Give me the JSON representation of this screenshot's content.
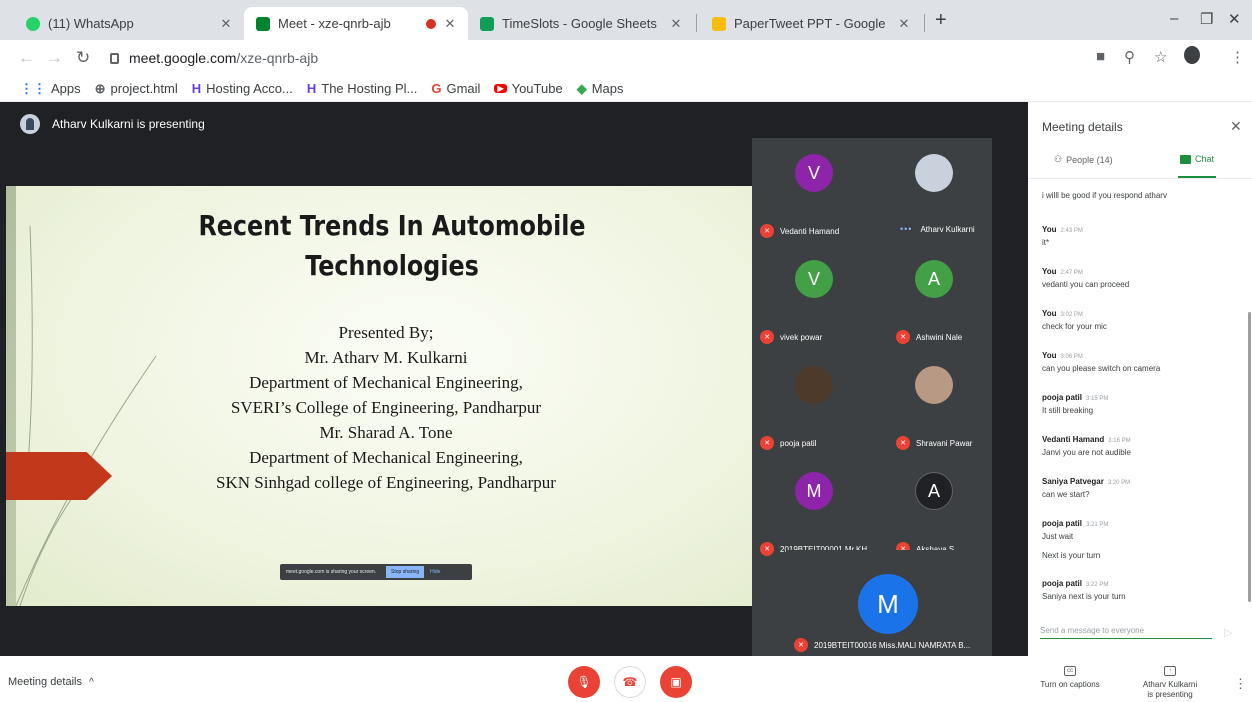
{
  "browser": {
    "tabs": [
      {
        "title": "(11) WhatsApp",
        "active": false,
        "favicon_color": "#25d366"
      },
      {
        "title": "Meet - xze-qnrb-ajb",
        "active": true,
        "recording": true,
        "favicon_color": "#00832d"
      },
      {
        "title": "TimeSlots - Google Sheets",
        "active": false,
        "favicon_color": "#0f9d58"
      },
      {
        "title": "PaperTweet PPT - Google",
        "active": false,
        "favicon_color": "#fbbc04"
      }
    ],
    "url_host": "meet.google.com",
    "url_path": "/xze-qnrb-ajb",
    "bookmarks": [
      {
        "label": "Apps",
        "icon": "apps-grid-icon"
      },
      {
        "label": "project.html",
        "icon": "globe-icon"
      },
      {
        "label": "Hosting Acco...",
        "icon": "hostinger-icon"
      },
      {
        "label": "The Hosting Pl...",
        "icon": "hostinger-icon"
      },
      {
        "label": "Gmail",
        "icon": "google-icon"
      },
      {
        "label": "YouTube",
        "icon": "youtube-icon"
      },
      {
        "label": "Maps",
        "icon": "maps-icon"
      }
    ]
  },
  "meet": {
    "presenter_banner": "Atharv Kulkarni is presenting",
    "slide": {
      "title_line1": "Recent Trends In Automobile",
      "title_line2": "Technologies",
      "body": [
        "Presented By;",
        "Mr. Atharv M. Kulkarni",
        "Department of Mechanical Engineering,",
        "SVERI’s College of Engineering, Pandharpur",
        "Mr. Sharad A. Tone",
        "Department of Mechanical Engineering,",
        "SKN Sinhgad college of Engineering, Pandharpur"
      ],
      "share_notice": "meet.google.com is sharing your screen.",
      "stop_sharing": "Stop sharing",
      "hide": "Hide"
    },
    "participants": [
      {
        "name": "Vedanti Hamand",
        "initial": "V",
        "color": "#8e24aa",
        "muted": true
      },
      {
        "name": "Atharv Kulkarni",
        "initial": "",
        "color": "#c9d2dc",
        "muted": false,
        "speaking": true
      },
      {
        "name": "vivek powar",
        "initial": "V",
        "color": "#43a047",
        "muted": true
      },
      {
        "name": "Ashwini Nale",
        "initial": "A",
        "color": "#43a047",
        "muted": true
      },
      {
        "name": "pooja patil",
        "initial": "",
        "color": "#4e3a2a",
        "muted": true
      },
      {
        "name": "Shravani Pawar",
        "initial": "",
        "color": "#b89a84",
        "muted": true
      },
      {
        "name": "2019BTEIT00001 Mr.KH...",
        "initial": "M",
        "color": "#8e24aa",
        "muted": true
      },
      {
        "name": "Akshaya S",
        "initial": "A",
        "color": "#202124",
        "muted": true
      }
    ],
    "featured": {
      "name": "2019BTEIT00016 Miss.MALI NAMRATA B...",
      "initial": "M",
      "muted": true
    }
  },
  "panel": {
    "title": "Meeting details",
    "people_tab": "People (14)",
    "chat_tab": "Chat",
    "messages": [
      {
        "sender": "",
        "time": "",
        "texts": [
          "i willl be good if you respond atharv"
        ]
      },
      {
        "sender": "You",
        "time": "2:43 PM",
        "texts": [
          "it*"
        ]
      },
      {
        "sender": "You",
        "time": "2:47 PM",
        "texts": [
          "vedanti you can proceed"
        ]
      },
      {
        "sender": "You",
        "time": "3:02 PM",
        "texts": [
          "check for your mic"
        ]
      },
      {
        "sender": "You",
        "time": "3:06 PM",
        "texts": [
          "can you please switch on camera"
        ]
      },
      {
        "sender": "pooja patil",
        "time": "3:15 PM",
        "texts": [
          "It still breaking"
        ]
      },
      {
        "sender": "Vedanti Hamand",
        "time": "3:16 PM",
        "texts": [
          "Janvi you are not audible"
        ]
      },
      {
        "sender": "Saniya Patvegar",
        "time": "3:20 PM",
        "texts": [
          "can we start?"
        ]
      },
      {
        "sender": "pooja patil",
        "time": "3:21 PM",
        "texts": [
          "Just wait",
          "Next is your turn"
        ]
      },
      {
        "sender": "pooja patil",
        "time": "3:22 PM",
        "texts": [
          "Saniya next is your turn"
        ]
      }
    ],
    "input_placeholder": "Send a message to everyone"
  },
  "bottom": {
    "meeting_details": "Meeting details",
    "captions": "Turn on captions",
    "presenting_line1": "Atharv Kulkarni",
    "presenting_line2": "is presenting"
  }
}
